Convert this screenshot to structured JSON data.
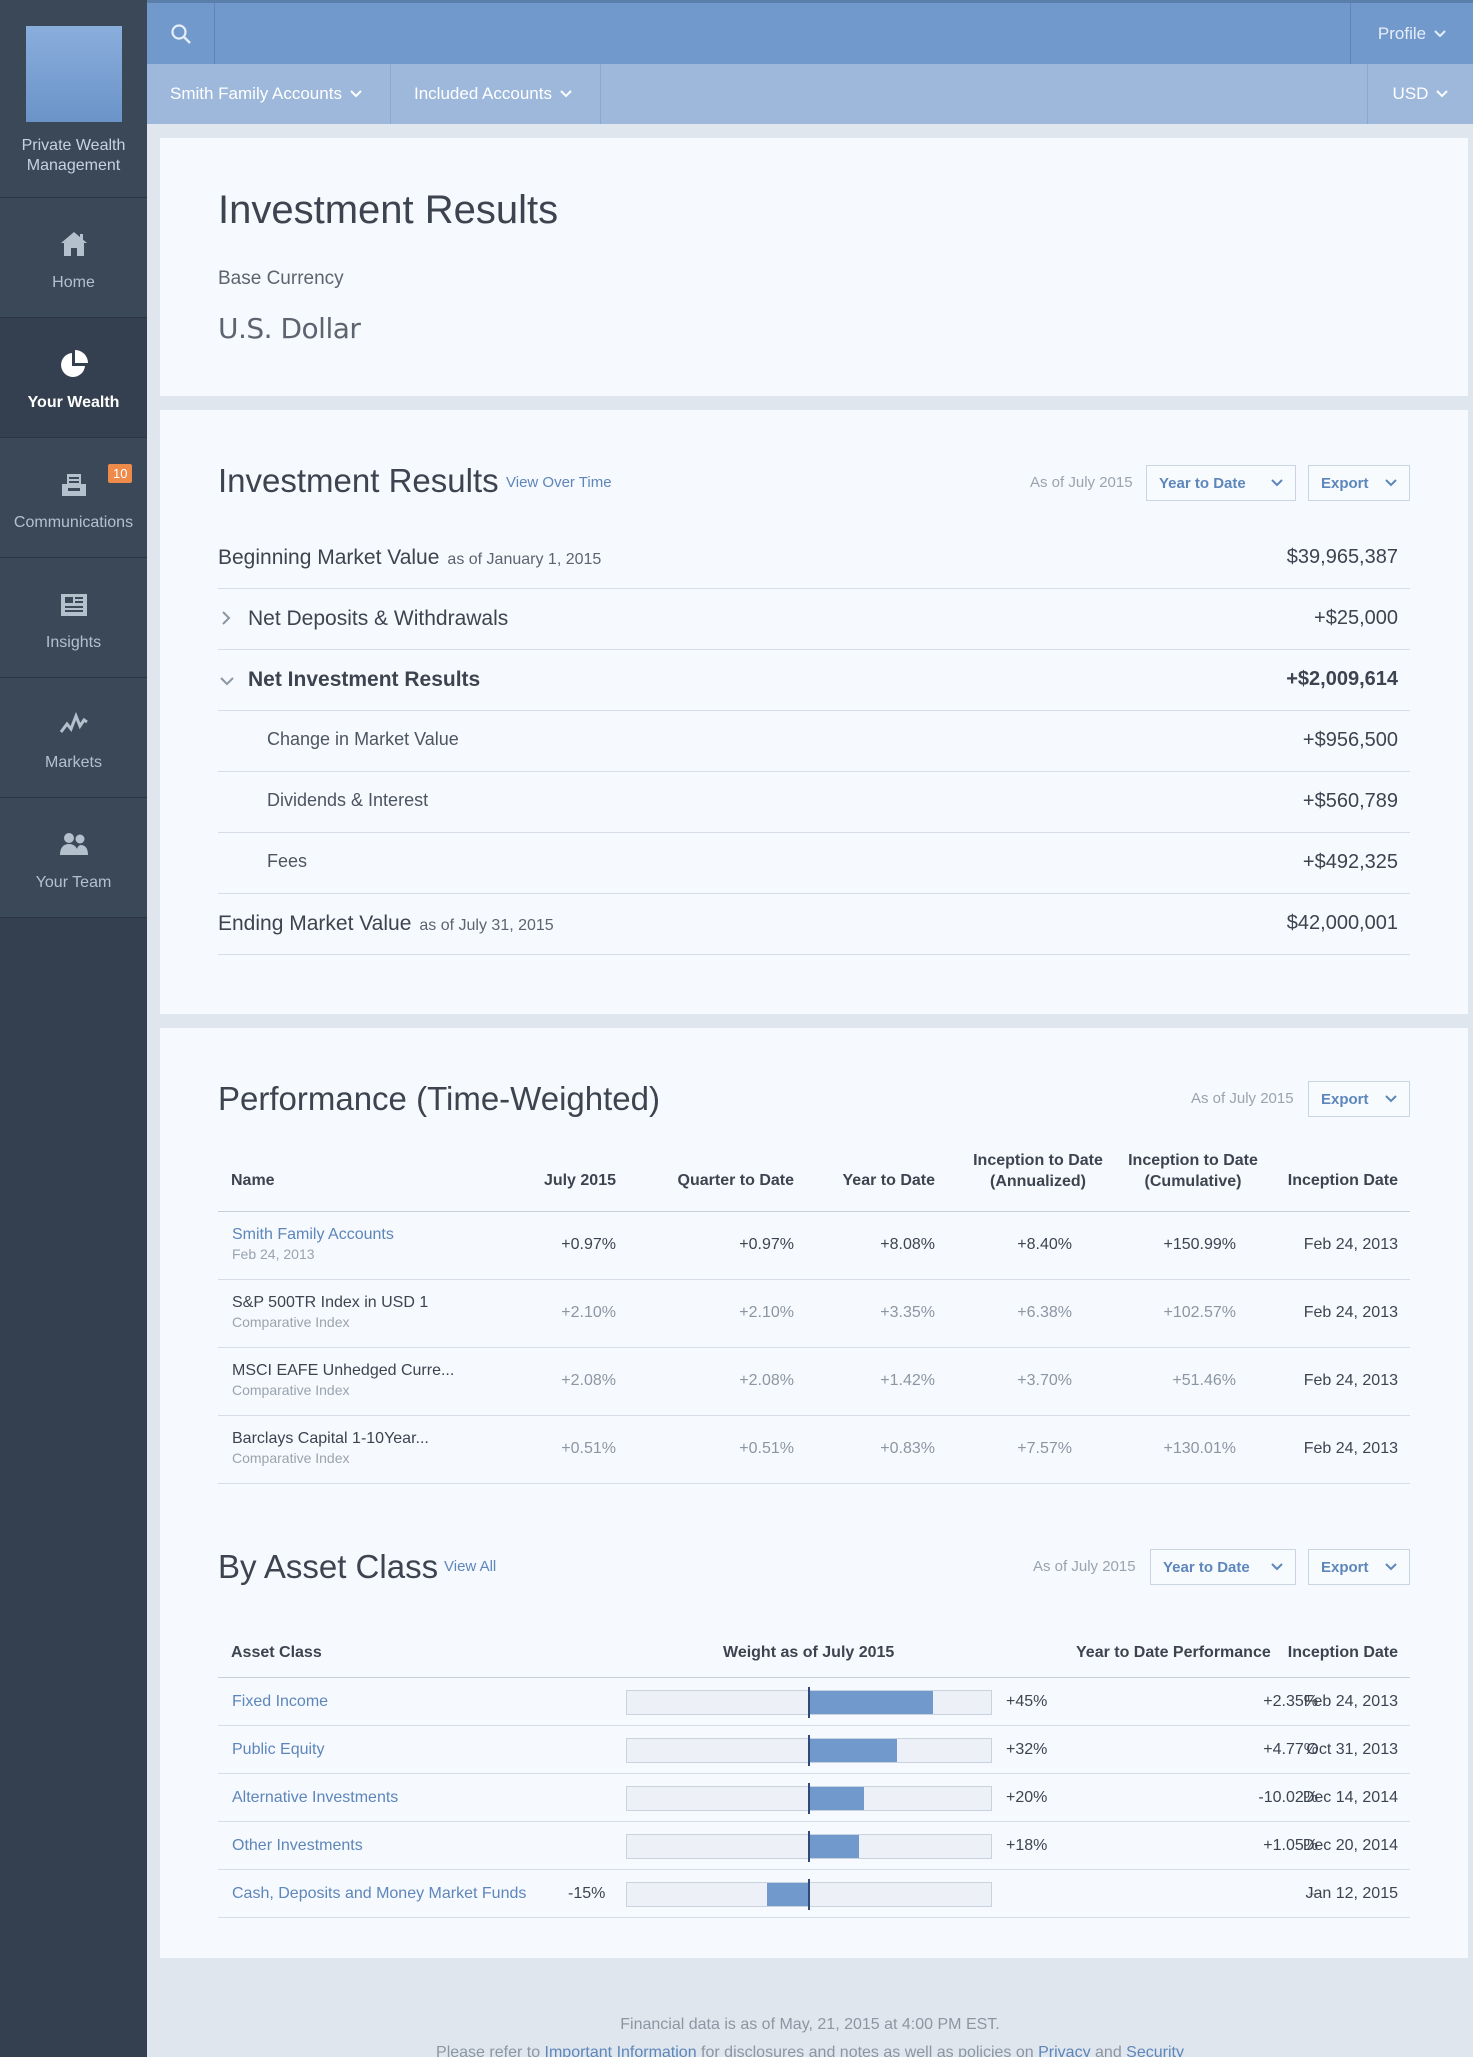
{
  "sidebar": {
    "brand": "Private Wealth Management",
    "items": [
      {
        "label": "Home",
        "icon": "home-icon"
      },
      {
        "label": "Your Wealth",
        "icon": "pie-chart-icon",
        "active": true
      },
      {
        "label": "Communications",
        "icon": "inbox-icon",
        "badge": "10"
      },
      {
        "label": "Insights",
        "icon": "book-icon"
      },
      {
        "label": "Markets",
        "icon": "chart-line-icon"
      },
      {
        "label": "Your Team",
        "icon": "team-icon"
      }
    ]
  },
  "topbar": {
    "profile_label": "Profile",
    "accounts_label": "Smith Family Accounts",
    "included_label": "Included Accounts",
    "currency_label": "USD"
  },
  "summary": {
    "title": "Investment Results",
    "base_currency_label": "Base Currency",
    "base_currency_value": "U.S. Dollar"
  },
  "results": {
    "title": "Investment Results",
    "view_over_time": "View Over Time",
    "as_of": "As of July 2015",
    "period": "Year to Date",
    "export": "Export",
    "rows": {
      "beginning": {
        "label": "Beginning Market Value",
        "sub": "as of January 1, 2015",
        "value": "$39,965,387"
      },
      "deposits": {
        "label": "Net Deposits & Withdrawals",
        "value": "+$25,000"
      },
      "net": {
        "label": "Net Investment Results",
        "value": "+$2,009,614"
      },
      "change": {
        "label": "Change in Market Value",
        "value": "+$956,500"
      },
      "dividends": {
        "label": "Dividends & Interest",
        "value": "+$560,789"
      },
      "fees": {
        "label": "Fees",
        "value": "+$492,325"
      },
      "ending": {
        "label": "Ending Market Value",
        "sub": "as of July 31, 2015",
        "value": "$42,000,001"
      }
    }
  },
  "performance": {
    "title": "Performance (Time-Weighted)",
    "as_of": "As of July 2015",
    "export": "Export",
    "headers": {
      "name": "Name",
      "month": "July 2015",
      "qtd": "Quarter to Date",
      "ytd": "Year to Date",
      "itd_ann_1": "Inception to Date",
      "itd_ann_2": "(Annualized)",
      "itd_cum_1": "Inception to Date",
      "itd_cum_2": "(Cumulative)",
      "inception": "Inception Date"
    },
    "rows": [
      {
        "name": "Smith Family Accounts",
        "sub": "Feb 24, 2013",
        "month": "+0.97%",
        "qtd": "+0.97%",
        "ytd": "+8.08%",
        "ann": "+8.40%",
        "cum": "+150.99%",
        "date": "Feb 24, 2013"
      },
      {
        "name": "S&P 500TR Index in USD 1",
        "sub": "Comparative Index",
        "month": "+2.10%",
        "qtd": "+2.10%",
        "ytd": "+3.35%",
        "ann": "+6.38%",
        "cum": "+102.57%",
        "date": "Feb 24, 2013"
      },
      {
        "name": "MSCI EAFE Unhedged Curre...",
        "sub": "Comparative Index",
        "month": "+2.08%",
        "qtd": "+2.08%",
        "ytd": "+1.42%",
        "ann": "+3.70%",
        "cum": "+51.46%",
        "date": "Feb 24, 2013"
      },
      {
        "name": "Barclays Capital 1-10Year...",
        "sub": "Comparative Index",
        "month": "+0.51%",
        "qtd": "+0.51%",
        "ytd": "+0.83%",
        "ann": "+7.57%",
        "cum": "+130.01%",
        "date": "Feb 24, 2013"
      }
    ]
  },
  "asset_class": {
    "title": "By Asset Class",
    "view_all": "View All",
    "as_of": "As of July 2015",
    "period": "Year to Date",
    "export": "Export",
    "headers": {
      "name": "Asset Class",
      "weight": "Weight as of July 2015",
      "ytd": "Year to Date Performance",
      "inception": "Inception Date"
    },
    "rows": [
      {
        "name": "Fixed Income",
        "weight_label": "+45%",
        "weight": 45,
        "ytd": "+2.35%",
        "date": "Feb 24, 2013"
      },
      {
        "name": "Public Equity",
        "weight_label": "+32%",
        "weight": 32,
        "ytd": "+4.77%",
        "date": "Oct 31, 2013"
      },
      {
        "name": "Alternative Investments",
        "weight_label": "+20%",
        "weight": 20,
        "ytd": "-10.02%",
        "date": "Dec 14, 2014"
      },
      {
        "name": "Other Investments",
        "weight_label": "+18%",
        "weight": 18,
        "ytd": "+1.05%",
        "date": "Dec 20, 2014"
      },
      {
        "name": "Cash, Deposits and Money Market Funds",
        "weight_label": "-15%",
        "weight": -15,
        "ytd": "–",
        "date": "Jan 12, 2015"
      }
    ]
  },
  "footer": {
    "line1": "Financial data is as of May, 21, 2015 at 4:00 PM EST.",
    "line2_a": "Please refer to ",
    "line2_link1": "Important Information",
    "line2_b": " for disclosures and notes as well as policies on ",
    "line2_link2": "Privacy",
    "line2_c": " and ",
    "line2_link3": "Security"
  }
}
